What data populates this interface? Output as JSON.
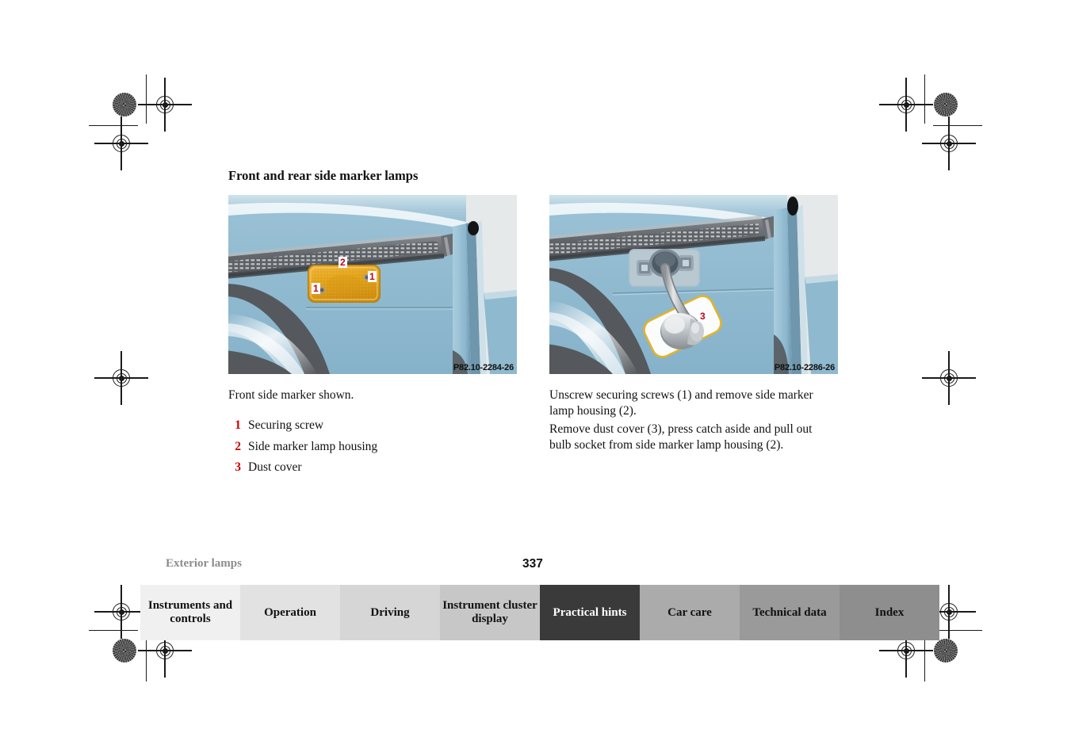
{
  "document": {
    "heading": "Front and rear side marker lamps",
    "running_head": "Exterior lamps",
    "page_number": "337"
  },
  "figures": {
    "left": {
      "code": "P82.10-2284-26",
      "callouts": [
        {
          "label": "2"
        },
        {
          "label": "1"
        },
        {
          "label": "1"
        }
      ]
    },
    "right": {
      "code": "P82.10-2286-26",
      "callouts": [
        {
          "label": "3"
        }
      ]
    }
  },
  "left_column": {
    "caption": "Front side marker shown.",
    "legend": [
      {
        "num": "1",
        "text": "Securing screw"
      },
      {
        "num": "2",
        "text": "Side marker lamp housing"
      },
      {
        "num": "3",
        "text": "Dust cover"
      }
    ]
  },
  "right_column": {
    "paragraphs": [
      "Unscrew securing screws (1) and remove side marker lamp housing (2).",
      "Remove dust cover (3), press catch aside and pull out bulb socket from side marker lamp housing (2)."
    ]
  },
  "footer_tabs": [
    {
      "label": "Instruments and controls",
      "active": false,
      "bg": "#f0f0f0"
    },
    {
      "label": "Operation",
      "active": false,
      "bg": "#e2e2e2"
    },
    {
      "label": "Driving",
      "active": false,
      "bg": "#d6d6d6"
    },
    {
      "label": "Instrument cluster display",
      "active": false,
      "bg": "#c7c7c7"
    },
    {
      "label": "Practical hints",
      "active": true,
      "bg": "#3a3a3a"
    },
    {
      "label": "Car care",
      "active": false,
      "bg": "#ababab"
    },
    {
      "label": "Technical data",
      "active": false,
      "bg": "#9a9a9a"
    },
    {
      "label": "Index",
      "active": false,
      "bg": "#8e8e8e"
    }
  ],
  "colors": {
    "callout_red": "#c20017",
    "legend_red": "#cc0000",
    "running_head_gray": "#8c8c8c",
    "body_blue": "#8fb9cf",
    "figure_bg_gray": "#e6e9ea",
    "lamp_amber": "#e8a81e"
  }
}
